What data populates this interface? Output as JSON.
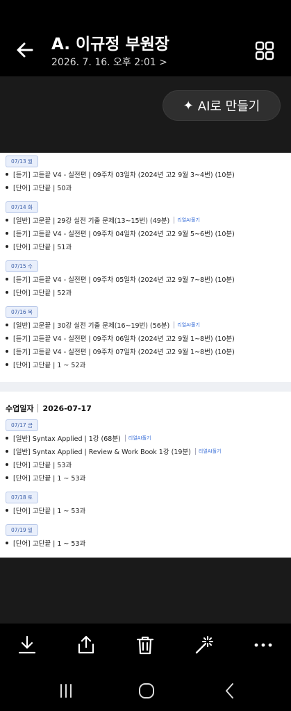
{
  "header": {
    "title": "A. 이규정 부원장",
    "subtitle": "2026. 7. 16. 오후 2:01 >"
  },
  "ai_button": {
    "label": "AI로 만들기",
    "icon": "sparkle-icon"
  },
  "schedule": {
    "week1": [
      {
        "day": "07/13 월",
        "items": [
          {
            "text": "[듣기] 고듣끝 V4 - 실전편 | 09주차 03일차 (2024년 고2 9월 3~4번) (10분)",
            "tag": ""
          },
          {
            "text": "[단어] 고단끝 | 50과",
            "tag": ""
          }
        ]
      },
      {
        "day": "07/14 화",
        "items": [
          {
            "text": "[일반] 고문끝 | 29강 실전 기출 문제(13~15번) (49분)",
            "tag": "리얼AI풀기"
          },
          {
            "text": "[듣기] 고듣끝 V4 - 실전편 | 09주차 04일차 (2024년 고2 9월 5~6번) (10분)",
            "tag": ""
          },
          {
            "text": "[단어] 고단끝 | 51과",
            "tag": ""
          }
        ]
      },
      {
        "day": "07/15 수",
        "items": [
          {
            "text": "[듣기] 고듣끝 V4 - 실전편 | 09주차 05일차 (2024년 고2 9월 7~8번) (10분)",
            "tag": ""
          },
          {
            "text": "[단어] 고단끝 | 52과",
            "tag": ""
          }
        ]
      },
      {
        "day": "07/16 목",
        "items": [
          {
            "text": "[일반] 고문끝 | 30강 실전 기출 문제(16~19번) (56분)",
            "tag": "리얼AI풀기"
          },
          {
            "text": "[듣기] 고듣끝 V4 - 실전편 | 09주차 06일차 (2024년 고2 9월 1~8번) (10분)",
            "tag": ""
          },
          {
            "text": "[듣기] 고듣끝 V4 - 실전편 | 09주차 07일차 (2024년 고2 9월 1~8번) (10분)",
            "tag": ""
          },
          {
            "text": "[단어] 고단끝 | 1 ~ 52과",
            "tag": ""
          }
        ]
      }
    ],
    "date_header": {
      "label": "수업일자",
      "date": "2026-07-17"
    },
    "week2": [
      {
        "day": "07/17 금",
        "items": [
          {
            "text": "[일반] Syntax Applied | 1강 (68분)",
            "tag": "리얼AI풀기"
          },
          {
            "text": "[일반] Syntax Applied | Review & Work Book 1강 (19분)",
            "tag": "리얼AI풀기"
          },
          {
            "text": "[단어] 고단끝 | 53과",
            "tag": ""
          },
          {
            "text": "[단어] 고단끝 | 1 ~ 53과",
            "tag": ""
          }
        ]
      },
      {
        "day": "07/18 토",
        "items": [
          {
            "text": "[단어] 고단끝 | 1 ~ 53과",
            "tag": ""
          }
        ]
      },
      {
        "day": "07/19 일",
        "items": [
          {
            "text": "[단어] 고단끝 | 1 ~ 53과",
            "tag": ""
          }
        ]
      }
    ]
  },
  "toolbar": {
    "icons": [
      "download-icon",
      "share-icon",
      "trash-icon",
      "magic-wand-icon",
      "more-icon"
    ]
  },
  "navbar": {
    "icons": [
      "recent-apps-icon",
      "home-icon",
      "back-nav-icon"
    ]
  }
}
